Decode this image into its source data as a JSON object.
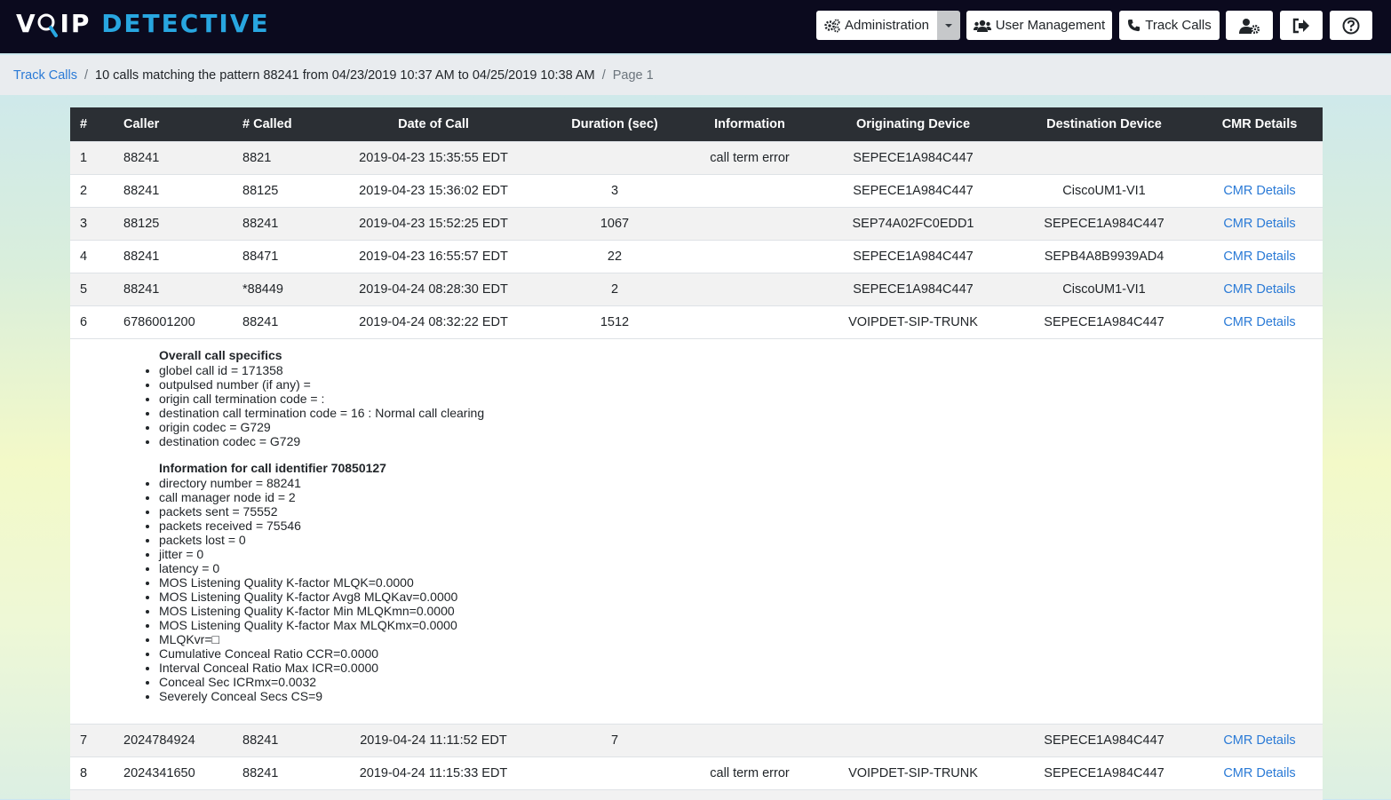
{
  "brand": {
    "part1": "V",
    "o": "O",
    "part2": "IP",
    "part3": "DETECTIVE"
  },
  "nav": {
    "administration": "Administration",
    "user_management": "User Management",
    "track_calls": "Track Calls"
  },
  "breadcrumb": {
    "link": "Track Calls",
    "current": "10 calls matching the pattern 88241 from 04/23/2019 10:37 AM to 04/25/2019 10:38 AM",
    "page": "Page 1"
  },
  "table": {
    "headers": [
      "#",
      "Caller",
      "# Called",
      "Date of Call",
      "Duration (sec)",
      "Information",
      "Originating Device",
      "Destination Device",
      "CMR Details"
    ],
    "rows": [
      {
        "num": "1",
        "caller": "88241",
        "called": "8821",
        "date": "2019-04-23 15:35:55 EDT",
        "duration": "",
        "info": "call term error",
        "orig": "SEPECE1A984C447",
        "dest": "",
        "cmr": ""
      },
      {
        "num": "2",
        "caller": "88241",
        "called": "88125",
        "date": "2019-04-23 15:36:02 EDT",
        "duration": "3",
        "info": "",
        "orig": "SEPECE1A984C447",
        "dest": "CiscoUM1-VI1",
        "cmr": "CMR Details"
      },
      {
        "num": "3",
        "caller": "88125",
        "called": "88241",
        "date": "2019-04-23 15:52:25 EDT",
        "duration": "1067",
        "info": "",
        "orig": "SEP74A02FC0EDD1",
        "dest": "SEPECE1A984C447",
        "cmr": "CMR Details"
      },
      {
        "num": "4",
        "caller": "88241",
        "called": "88471",
        "date": "2019-04-23 16:55:57 EDT",
        "duration": "22",
        "info": "",
        "orig": "SEPECE1A984C447",
        "dest": "SEPB4A8B9939AD4",
        "cmr": "CMR Details"
      },
      {
        "num": "5",
        "caller": "88241",
        "called": "*88449",
        "date": "2019-04-24 08:28:30 EDT",
        "duration": "2",
        "info": "",
        "orig": "SEPECE1A984C447",
        "dest": "CiscoUM1-VI1",
        "cmr": "CMR Details"
      },
      {
        "num": "6",
        "caller": "6786001200",
        "called": "88241",
        "date": "2019-04-24 08:32:22 EDT",
        "duration": "1512",
        "info": "",
        "orig": "VOIPDET-SIP-TRUNK",
        "dest": "SEPECE1A984C447",
        "cmr": "CMR Details"
      },
      {
        "num": "7",
        "caller": "2024784924",
        "called": "88241",
        "date": "2019-04-24 11:11:52 EDT",
        "duration": "7",
        "info": "",
        "orig": "",
        "dest": "SEPECE1A984C447",
        "cmr": "CMR Details"
      },
      {
        "num": "8",
        "caller": "2024341650",
        "called": "88241",
        "date": "2019-04-24 11:15:33 EDT",
        "duration": "",
        "info": "call term error",
        "orig": "VOIPDET-SIP-TRUNK",
        "dest": "SEPECE1A984C447",
        "cmr": "CMR Details"
      }
    ]
  },
  "details": {
    "overall_title": "Overall call specifics",
    "overall": [
      "globel call id = 171358",
      "outpulsed number (if any) =",
      "origin call termination code = :",
      "destination call termination code = 16 : Normal call clearing",
      "origin codec = G729",
      "destination codec = G729"
    ],
    "info_title": "Information for call identifier 70850127",
    "info": [
      "directory number = 88241",
      "call manager node id = 2",
      "packets sent = 75552",
      "packets received = 75546",
      "packets lost = 0",
      "jitter = 0",
      "latency = 0",
      "MOS Listening Quality K-factor MLQK=0.0000",
      "MOS Listening Quality K-factor Avg8 MLQKav=0.0000",
      "MOS Listening Quality K-factor Min MLQKmn=0.0000",
      "MOS Listening Quality K-factor Max MLQKmx=0.0000",
      "MLQKvr=□",
      "Cumulative Conceal Ratio CCR=0.0000",
      "Interval Conceal Ratio Max ICR=0.0000",
      "Conceal Sec ICRmx=0.0032",
      "Severely Conceal Secs CS=9"
    ]
  }
}
